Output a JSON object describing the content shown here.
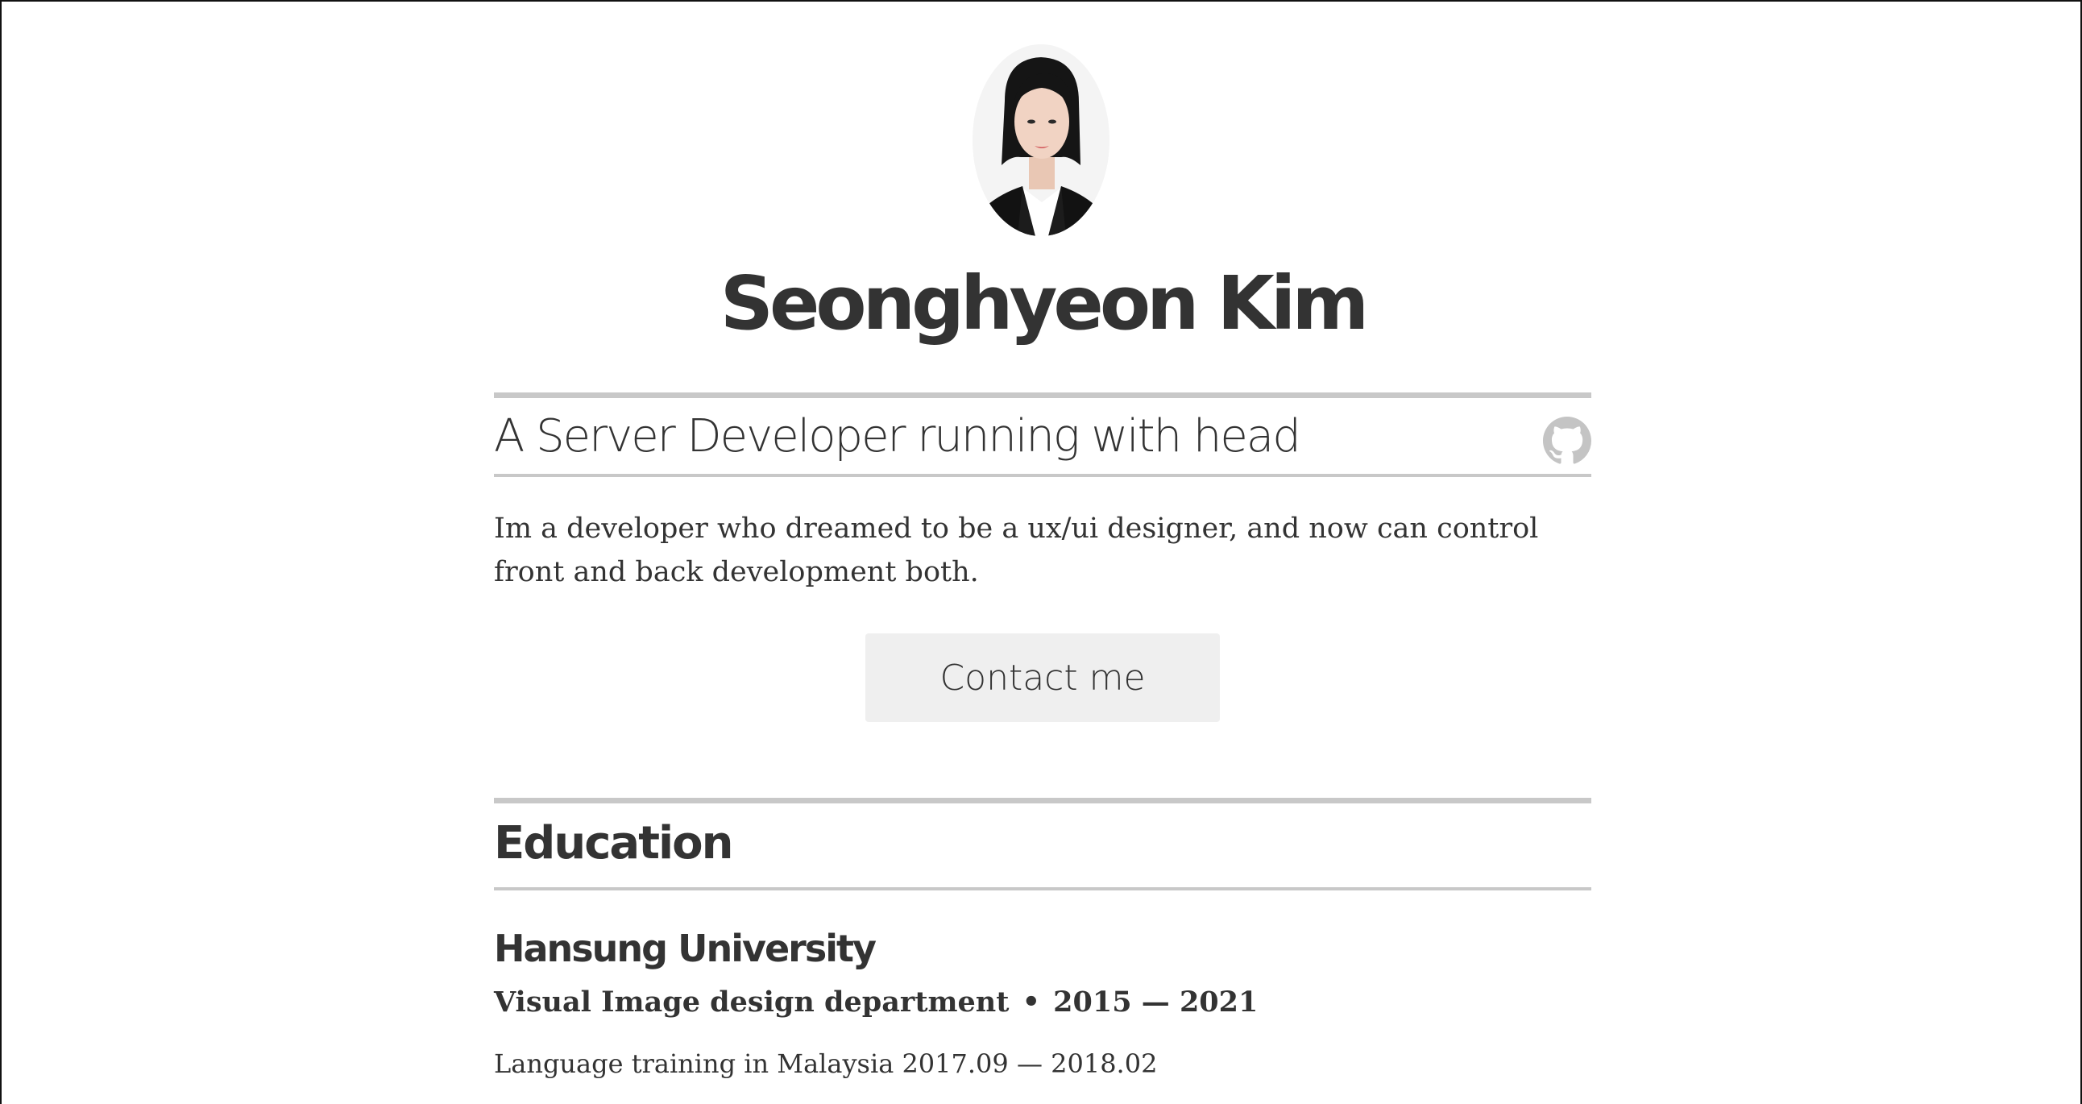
{
  "profile": {
    "avatar_icon": "profile-photo",
    "name": "Seonghyeon Kim",
    "tagline": "A Server Developer running with head",
    "github_icon": "github-icon",
    "intro": "Im a developer who dreamed to be a ux/ui designer, and now can control front and back development both.",
    "contact_label": "Contact me"
  },
  "education": {
    "heading": "Education",
    "items": [
      {
        "school": "Hansung University",
        "department": "Visual Image design department",
        "separator": "•",
        "period": "2015 — 2021",
        "note": "Language training in Malaysia 2017.09 — 2018.02"
      }
    ]
  },
  "colors": {
    "text": "#333333",
    "rule": "#c8c8c8",
    "button_bg": "#efefef",
    "icon": "#c4c4c4"
  }
}
